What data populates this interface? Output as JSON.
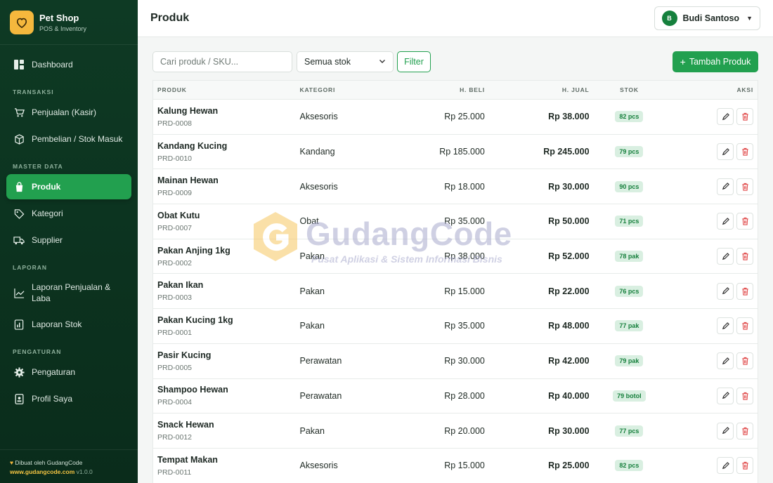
{
  "brand": {
    "title": "Pet Shop",
    "subtitle": "POS & Inventory",
    "logo_color": "#f5b83d"
  },
  "sidebar": {
    "items": [
      {
        "label": "Dashboard",
        "icon": "dashboard-icon"
      },
      {
        "section": "TRANSAKSI"
      },
      {
        "label": "Penjualan (Kasir)",
        "icon": "cart-icon"
      },
      {
        "label": "Pembelian / Stok Masuk",
        "icon": "box-icon"
      },
      {
        "section": "MASTER DATA"
      },
      {
        "label": "Produk",
        "icon": "bag-icon",
        "active": true
      },
      {
        "label": "Kategori",
        "icon": "tag-icon"
      },
      {
        "label": "Supplier",
        "icon": "truck-icon"
      },
      {
        "section": "LAPORAN"
      },
      {
        "label": "Laporan Penjualan & Laba",
        "icon": "chart-line-icon"
      },
      {
        "label": "Laporan Stok",
        "icon": "report-icon"
      },
      {
        "section": "PENGATURAN"
      },
      {
        "label": "Pengaturan",
        "icon": "gear-icon"
      },
      {
        "label": "Profil Saya",
        "icon": "profile-icon"
      }
    ],
    "footer": {
      "made_by": "Dibuat oleh GudangCode",
      "link": "www.gudangcode.com",
      "version": "v1.0.0"
    }
  },
  "header": {
    "title": "Produk",
    "user": {
      "initial": "B",
      "name": "Budi Santoso"
    }
  },
  "toolbar": {
    "search_placeholder": "Cari produk / SKU...",
    "stock_filter": "Semua stok",
    "filter_label": "Filter",
    "add_label": "Tambah Produk"
  },
  "table": {
    "columns": [
      "PRODUK",
      "KATEGORI",
      "H. BELI",
      "H. JUAL",
      "STOK",
      "AKSI"
    ],
    "rows": [
      {
        "name": "Kalung Hewan",
        "sku": "PRD-0008",
        "kategori": "Aksesoris",
        "beli": "Rp 25.000",
        "jual": "Rp 38.000",
        "stok": "82 pcs"
      },
      {
        "name": "Kandang Kucing",
        "sku": "PRD-0010",
        "kategori": "Kandang",
        "beli": "Rp 185.000",
        "jual": "Rp 245.000",
        "stok": "79 pcs"
      },
      {
        "name": "Mainan Hewan",
        "sku": "PRD-0009",
        "kategori": "Aksesoris",
        "beli": "Rp 18.000",
        "jual": "Rp 30.000",
        "stok": "90 pcs"
      },
      {
        "name": "Obat Kutu",
        "sku": "PRD-0007",
        "kategori": "Obat",
        "beli": "Rp 35.000",
        "jual": "Rp 50.000",
        "stok": "71 pcs"
      },
      {
        "name": "Pakan Anjing 1kg",
        "sku": "PRD-0002",
        "kategori": "Pakan",
        "beli": "Rp 38.000",
        "jual": "Rp 52.000",
        "stok": "78 pak"
      },
      {
        "name": "Pakan Ikan",
        "sku": "PRD-0003",
        "kategori": "Pakan",
        "beli": "Rp 15.000",
        "jual": "Rp 22.000",
        "stok": "76 pcs"
      },
      {
        "name": "Pakan Kucing 1kg",
        "sku": "PRD-0001",
        "kategori": "Pakan",
        "beli": "Rp 35.000",
        "jual": "Rp 48.000",
        "stok": "77 pak"
      },
      {
        "name": "Pasir Kucing",
        "sku": "PRD-0005",
        "kategori": "Perawatan",
        "beli": "Rp 30.000",
        "jual": "Rp 42.000",
        "stok": "79 pak"
      },
      {
        "name": "Shampoo Hewan",
        "sku": "PRD-0004",
        "kategori": "Perawatan",
        "beli": "Rp 28.000",
        "jual": "Rp 40.000",
        "stok": "79 botol"
      },
      {
        "name": "Snack Hewan",
        "sku": "PRD-0012",
        "kategori": "Pakan",
        "beli": "Rp 20.000",
        "jual": "Rp 30.000",
        "stok": "77 pcs"
      },
      {
        "name": "Tempat Makan",
        "sku": "PRD-0011",
        "kategori": "Aksesoris",
        "beli": "Rp 15.000",
        "jual": "Rp 25.000",
        "stok": "82 pcs"
      }
    ]
  },
  "watermark": {
    "title": "GudangCode",
    "subtitle": "Pusat Aplikasi & Sistem Informasi Bisnis"
  },
  "colors": {
    "sidebar_bg": "#0e3a24",
    "accent": "#22a04f",
    "badge_bg": "#d9efe1",
    "delete": "#e04848"
  }
}
